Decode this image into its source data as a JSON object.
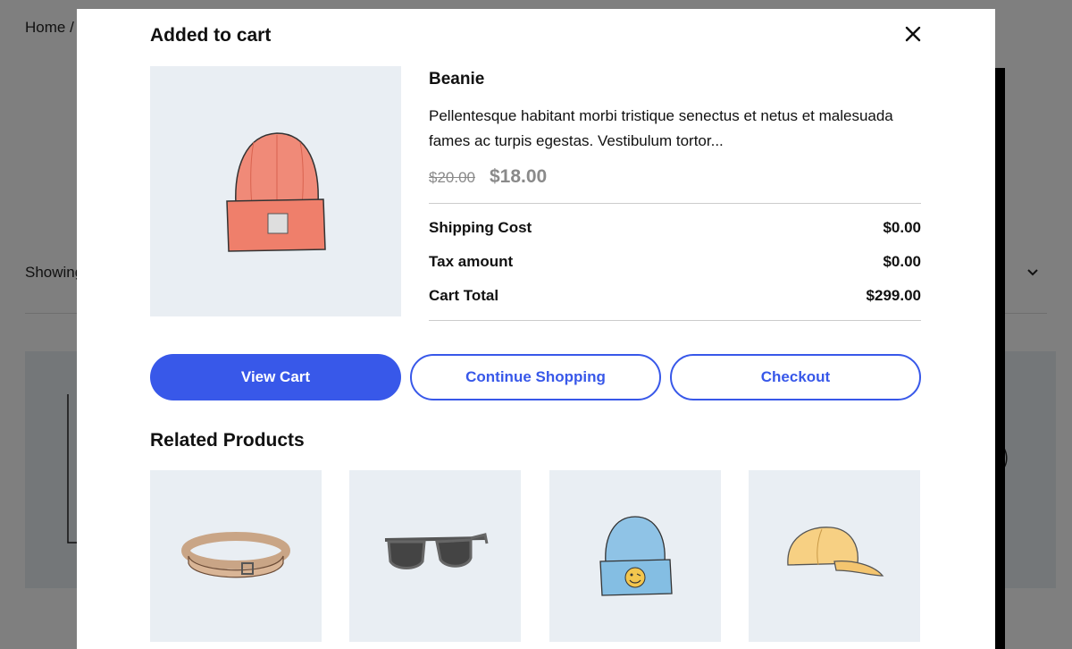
{
  "background": {
    "breadcrumb": "Home /",
    "showing_text": "Showing"
  },
  "modal": {
    "title": "Added to cart",
    "product": {
      "name": "Beanie",
      "description": "Pellentesque habitant morbi tristique senectus et netus et malesuada fames ac turpis egestas. Vestibulum tortor...",
      "regular_price": "$20.00",
      "sale_price": "$18.00",
      "image_icon": "beanie-orange"
    },
    "totals": [
      {
        "label": "Shipping Cost",
        "value": "$0.00"
      },
      {
        "label": "Tax amount",
        "value": "$0.00"
      },
      {
        "label": "Cart Total",
        "value": "$299.00"
      }
    ],
    "buttons": {
      "view_cart": "View Cart",
      "continue_shopping": "Continue Shopping",
      "checkout": "Checkout"
    },
    "related_title": "Related Products",
    "related_products": [
      {
        "icon": "belt"
      },
      {
        "icon": "sunglasses"
      },
      {
        "icon": "beanie-with-logo"
      },
      {
        "icon": "cap"
      }
    ]
  },
  "colors": {
    "accent": "#3858e9",
    "image_bg": "#e9eef3",
    "price_muted": "#8a8a8a"
  }
}
